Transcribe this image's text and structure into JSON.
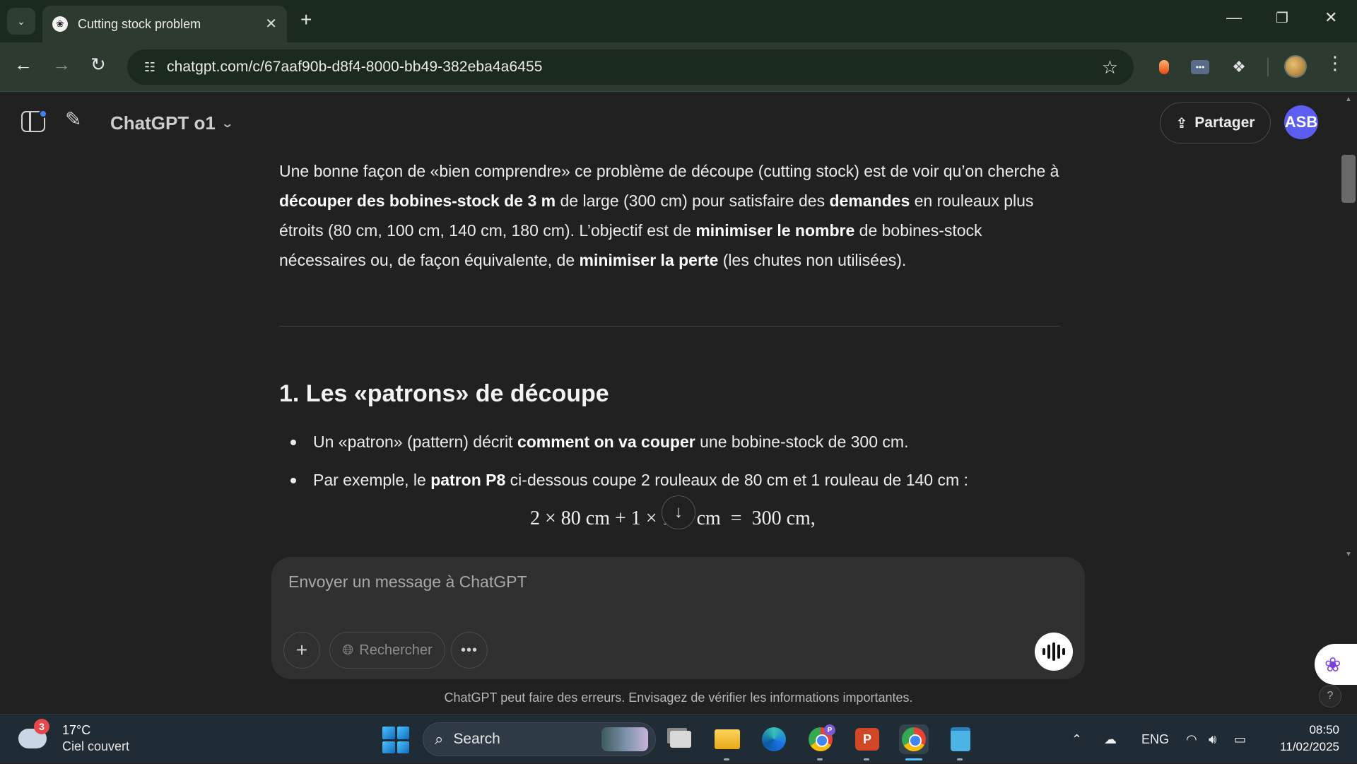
{
  "browser": {
    "tab_title": "Cutting stock problem",
    "url": "chatgpt.com/c/67aaf90b-d8f4-8000-bb49-382eba4a6455"
  },
  "header": {
    "model_label": "ChatGPT o1",
    "share_label": "Partager",
    "avatar_initials": "ASB"
  },
  "article": {
    "intro": [
      {
        "t": "Une bonne façon de «bien comprendre» ce problème de découpe (cutting stock) est de voir qu’on cherche à ",
        "b": false
      },
      {
        "t": "découper des bobines-stock de 3 m",
        "b": true
      },
      {
        "t": " de large (300 cm) pour satisfaire des ",
        "b": false
      },
      {
        "t": "demandes",
        "b": true
      },
      {
        "t": " en rouleaux plus étroits (80 cm, 100 cm, 140 cm, 180 cm). L’objectif est de ",
        "b": false
      },
      {
        "t": "minimiser le nombre",
        "b": true
      },
      {
        "t": " de bobines-stock nécessaires ou, de façon équivalente, de ",
        "b": false
      },
      {
        "t": "minimiser la perte",
        "b": true
      },
      {
        "t": " (les chutes non utilisées).",
        "b": false
      }
    ],
    "section_title": "1. Les «patrons» de découpe",
    "bullet1": [
      {
        "t": "Un «patron» (pattern) décrit ",
        "b": false
      },
      {
        "t": "comment on va couper",
        "b": true
      },
      {
        "t": " une bobine-stock de 300 cm.",
        "b": false
      }
    ],
    "bullet2": [
      {
        "t": "Par exemple, le ",
        "b": false
      },
      {
        "t": "patron P8",
        "b": true
      },
      {
        "t": " ci-dessous coupe 2 rouleaux de 80 cm et 1 rouleau de 140 cm :",
        "b": false
      }
    ],
    "equation": "2 × 80 cm + 1 × 140 cm  =  300 cm,"
  },
  "composer": {
    "placeholder": "Envoyer un message à ChatGPT",
    "search_label": "Rechercher"
  },
  "disclaimer": "ChatGPT peut faire des erreurs. Envisagez de vérifier les informations importantes.",
  "taskbar": {
    "weather_badge": "3",
    "temperature": "17°C",
    "condition": "Ciel couvert",
    "search_label": "Search",
    "language": "ENG",
    "time": "08:50",
    "date": "11/02/2025"
  },
  "colors": {
    "page_bg": "#212121",
    "composer_bg": "#303030",
    "avatar_bg": "#5b5ef0",
    "browser_frame": "#1b2a1f",
    "taskbar_bg": "#1f2b35"
  }
}
